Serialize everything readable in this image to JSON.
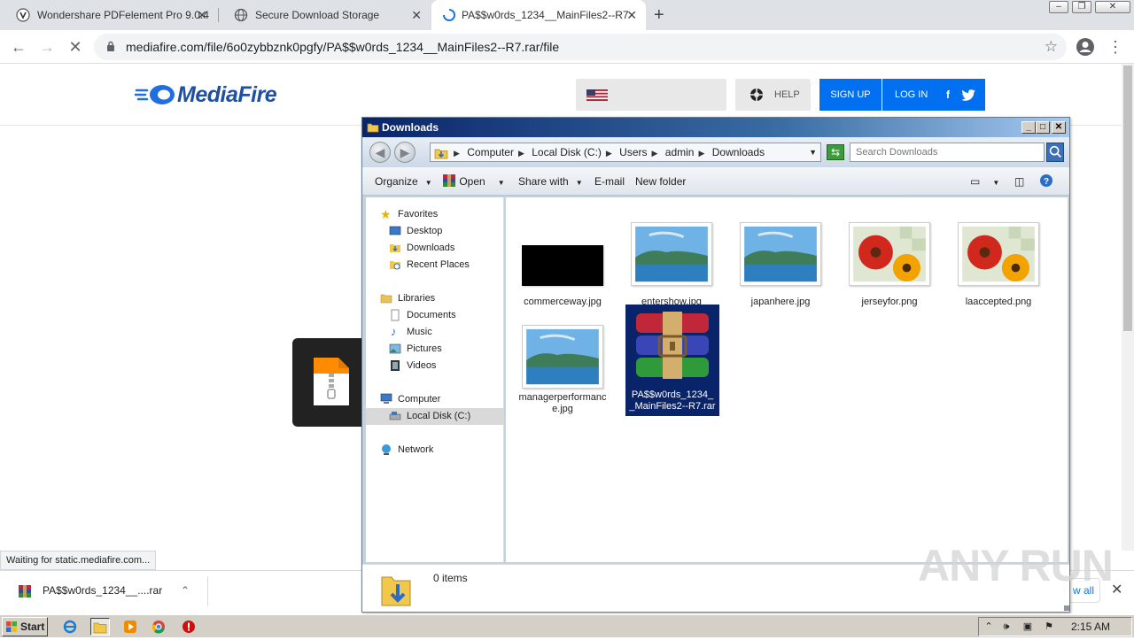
{
  "browser": {
    "tabs": [
      {
        "title": "Wondershare PDFelement Pro 9.0.4",
        "active": false
      },
      {
        "title": "Secure Download Storage",
        "active": false
      },
      {
        "title": "PA$$w0rds_1234__MainFiles2--R7",
        "active": true
      }
    ],
    "new_tab_glyph": "+",
    "close_glyph": "✕",
    "url": "mediafire.com/file/6o0zybbznk0pgfy/PA$$w0rds_1234__MainFiles2--R7.rar/file",
    "status_text": "Waiting for static.mediafire.com..."
  },
  "mediafire": {
    "logo_text": "MediaFire",
    "help_label": "HELP",
    "signup_label": "SIGN UP",
    "login_label": "LOG IN",
    "brand_color": "#0070f0"
  },
  "download_shelf": {
    "item_name": "PA$$w0rds_1234__....rar",
    "show_all_label": "w all"
  },
  "explorer": {
    "title": "Downloads",
    "breadcrumbs": [
      "Computer",
      "Local Disk (C:)",
      "Users",
      "admin",
      "Downloads"
    ],
    "search_placeholder": "Search Downloads",
    "commands": {
      "organize": "Organize",
      "open": "Open",
      "share_with": "Share with",
      "email": "E-mail",
      "new_folder": "New folder"
    },
    "nav": {
      "favorites": "Favorites",
      "desktop": "Desktop",
      "downloads": "Downloads",
      "recent_places": "Recent Places",
      "libraries": "Libraries",
      "documents": "Documents",
      "music": "Music",
      "pictures": "Pictures",
      "videos": "Videos",
      "computer": "Computer",
      "local_disk": "Local Disk (C:)",
      "network": "Network"
    },
    "files": [
      {
        "name": "commerceway.jpg",
        "thumb": "black-image"
      },
      {
        "name": "entershow.jpg",
        "thumb": "landscape-image"
      },
      {
        "name": "japanhere.jpg",
        "thumb": "landscape-image"
      },
      {
        "name": "jerseyfor.png",
        "thumb": "flower-image"
      },
      {
        "name": "laaccepted.png",
        "thumb": "flower-image"
      },
      {
        "name": "managerperformance.jpg",
        "thumb": "landscape-image"
      },
      {
        "name": "PA$$w0rds_1234__MainFiles2--R7.rar",
        "thumb": "winrar-archive-icon",
        "selected": true
      }
    ],
    "details_text": "0 items"
  },
  "watermark": "ANY RUN",
  "taskbar": {
    "start_label": "Start",
    "clock": "2:15 AM"
  }
}
